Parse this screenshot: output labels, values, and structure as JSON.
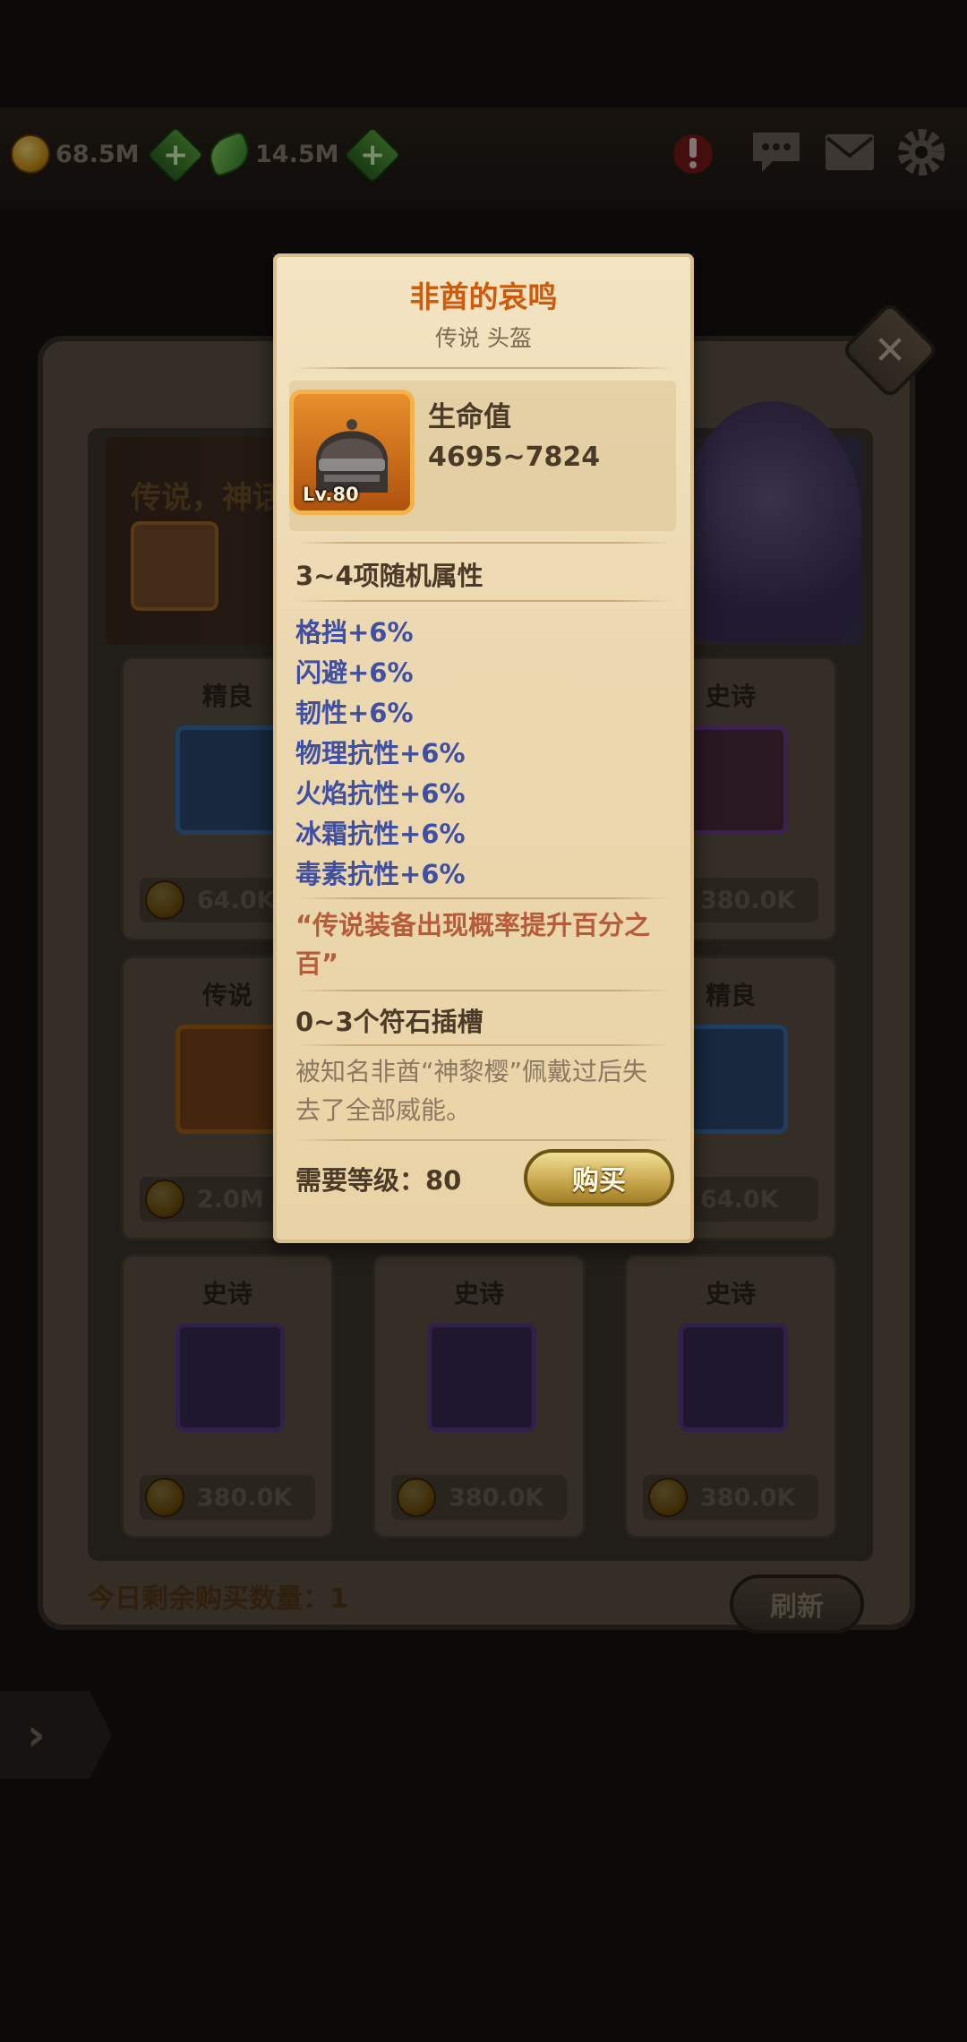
{
  "resources": {
    "gold": "68.5M",
    "gems": "14.5M"
  },
  "icons": {
    "gold": "coin-icon",
    "gem": "leaf-gem-icon",
    "plus": "plus-icon",
    "alert": "alert-icon",
    "chat": "chat-icon",
    "mail": "mail-icon",
    "settings": "gear-icon",
    "close": "close-icon",
    "back": "arrow-right-icon"
  },
  "banner": {
    "text": "传说，神话"
  },
  "shop": {
    "cards": [
      {
        "rarity": "精良",
        "price": "64.0K",
        "color": "#3b82d6"
      },
      {
        "rarity": "史诗",
        "price": "380.0K",
        "color": "#8a3fd0"
      },
      {
        "rarity": "传说",
        "price": "2.0M",
        "color": "#e08a20"
      },
      {
        "rarity": "精良",
        "price": "64.0K",
        "color": "#3b82d6"
      },
      {
        "rarity": "史诗",
        "price": "380.0K",
        "color": "#8a3fd0"
      },
      {
        "rarity": "史诗",
        "price": "380.0K",
        "color": "#8a3fd0"
      },
      {
        "rarity": "史诗",
        "price": "380.0K",
        "color": "#8a3fd0"
      }
    ],
    "remaining_label": "今日剩余购买数量：1",
    "refresh_label": "刷新"
  },
  "tooltip": {
    "name": "非酋的哀鸣",
    "subtitle": "传说 头盔",
    "level_badge": "Lv.80",
    "main_stat_name": "生命值",
    "main_stat_value": "4695~7824",
    "random_header": "3~4项随机属性",
    "attributes": [
      "格挡+6%",
      "闪避+6%",
      "韧性+6%",
      "物理抗性+6%",
      "火焰抗性+6%",
      "冰霜抗性+6%",
      "毒素抗性+6%"
    ],
    "quote": "“传说装备出现概率提升百分之百”",
    "socket_header": "0~3个符石插槽",
    "description": "被知名非酋“神黎樱”佩戴过后失去了全部威能。",
    "requirement": "需要等级：80",
    "buy_label": "购买",
    "colors": {
      "title": "#cf5a0c",
      "attribute": "#3f4fa1",
      "quote": "#b75c3a"
    }
  }
}
